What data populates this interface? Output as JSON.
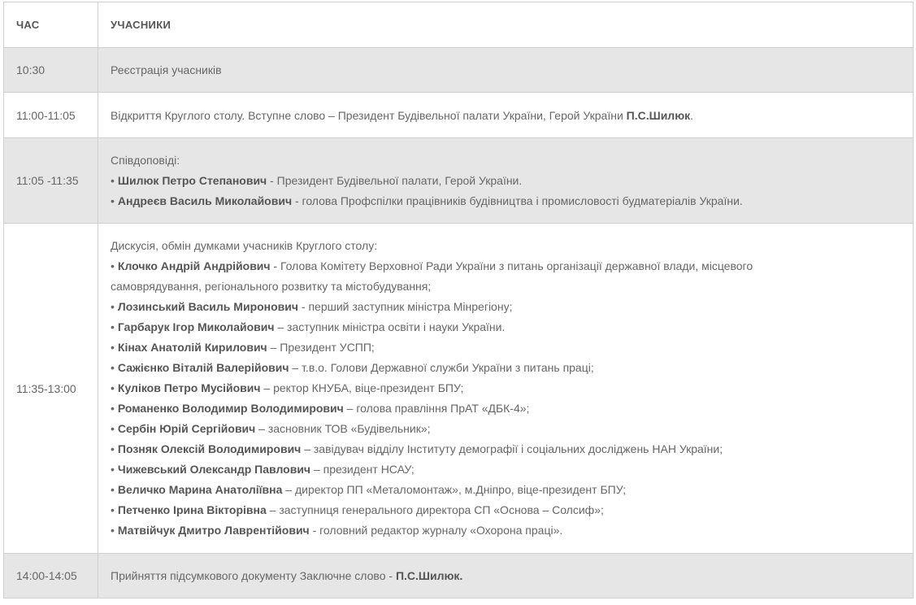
{
  "header": {
    "time": "ЧАС",
    "participants": "УЧАСНИКИ"
  },
  "rows": [
    {
      "time": "10:30",
      "text": "Реєстрація учасників"
    },
    {
      "time": "11:00-11:05",
      "text": "Відкриття Круглого столу. Вступне слово – Президент Будівельної палати України, Герой України ",
      "bold": "П.С.Шилюк",
      "suffix": "."
    },
    {
      "time": "11:05 -11:35",
      "intro": "Співдоповіді:",
      "items": [
        {
          "name": "Шилюк Петро Степанович",
          "role": " - Президент Будівельної палати, Герой України."
        },
        {
          "name": "Андреєв Василь Миколайович",
          "role": " - голова Профспілки працівників будівництва і промисловості будматеріалів України."
        }
      ]
    },
    {
      "time": "11:35-13:00",
      "intro": "Дискусія, обмін думками учасників Круглого столу:",
      "items": [
        {
          "name": "Клочко Андрій Андрійович",
          "role": " - Голова Комітету Верховної Ради України з питань організації державної влади, місцевого",
          "cont": "самоврядування, регіонального розвитку та містобудування;"
        },
        {
          "name": "Лозинський Василь Миронович",
          "role": " - перший заступник міністра Мінрегіону;"
        },
        {
          "name": "Гарбарук Ігор Миколайович",
          "role": " – заступник міністра освіти і науки України."
        },
        {
          "name": "Кінах Анатолій Кирилович",
          "role": " – Президент УСПП;"
        },
        {
          "name": "Сажієнко Віталій Валерійович",
          "role": " – т.в.о. Голови Державної служби України з питань праці;"
        },
        {
          "name": "Куліков Петро Мусійович",
          "role": " – ректор КНУБА, віце-президент БПУ;"
        },
        {
          "name": "Романенко Володимир Володимирович",
          "role": " – голова правління ПрАТ «ДБК-4»;"
        },
        {
          "name": "Сербін Юрій Сергійович",
          "role": " – засновник ТОВ «Будівельник»;"
        },
        {
          "name": "Позняк Олексій Володимирович",
          "role": " – завідувач відділу Інституту демографії і соціальних досліджень НАН України;"
        },
        {
          "name": "Чижевський Олександр Павлович",
          "role": " – президент НСАУ;"
        },
        {
          "name": "Величко Марина Анатоліївна",
          "role": " – директор ПП «Металомонтаж», м.Дніпро, віце-президент БПУ;"
        },
        {
          "name": "Петченко Ірина Вікторівна",
          "role": " – заступниця генерального директора СП «Основа – Солсиф»;"
        },
        {
          "name": "Матвійчук Дмитро Лаврентійович",
          "role": " - головний редактор журналу «Охорона праці»."
        }
      ]
    },
    {
      "time": "14:00-14:05",
      "text": "Прийняття підсумкового документу Заключне слово - ",
      "bold": "П.С.Шилюк."
    }
  ],
  "bullet": "•"
}
